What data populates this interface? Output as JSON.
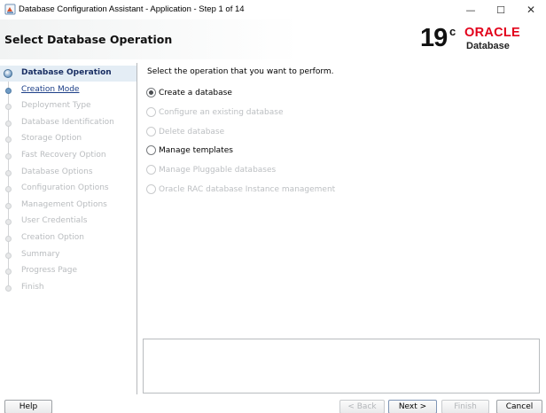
{
  "window": {
    "title": "Database Configuration Assistant - Application - Step 1 of 14",
    "minimize_glyph": "—",
    "maximize_glyph": "☐",
    "close_glyph": "✕"
  },
  "header": {
    "title": "Select Database Operation",
    "logo": {
      "version": "19",
      "superscript": "c",
      "brand": "ORACLE",
      "product": "Database",
      "brand_color": "#e2001a"
    }
  },
  "steps": [
    {
      "label": "Database Operation",
      "state": "active"
    },
    {
      "label": "Creation Mode",
      "state": "link"
    },
    {
      "label": "Deployment Type",
      "state": "disabled"
    },
    {
      "label": "Database Identification",
      "state": "disabled"
    },
    {
      "label": "Storage Option",
      "state": "disabled"
    },
    {
      "label": "Fast Recovery Option",
      "state": "disabled"
    },
    {
      "label": "Database Options",
      "state": "disabled"
    },
    {
      "label": "Configuration Options",
      "state": "disabled"
    },
    {
      "label": "Management Options",
      "state": "disabled"
    },
    {
      "label": "User Credentials",
      "state": "disabled"
    },
    {
      "label": "Creation Option",
      "state": "disabled"
    },
    {
      "label": "Summary",
      "state": "disabled"
    },
    {
      "label": "Progress Page",
      "state": "disabled"
    },
    {
      "label": "Finish",
      "state": "disabled"
    }
  ],
  "main": {
    "prompt": "Select the operation that you want to perform.",
    "options": [
      {
        "label": "Create a database",
        "selected": true,
        "enabled": true
      },
      {
        "label": "Configure an existing database",
        "selected": false,
        "enabled": false
      },
      {
        "label": "Delete database",
        "selected": false,
        "enabled": false
      },
      {
        "label": "Manage templates",
        "selected": false,
        "enabled": true
      },
      {
        "label": "Manage Pluggable databases",
        "selected": false,
        "enabled": false
      },
      {
        "label": "Oracle RAC database Instance management",
        "selected": false,
        "enabled": false
      }
    ]
  },
  "buttons": {
    "help": "Help",
    "back": "< Back",
    "next": "Next >",
    "finish": "Finish",
    "cancel": "Cancel"
  }
}
